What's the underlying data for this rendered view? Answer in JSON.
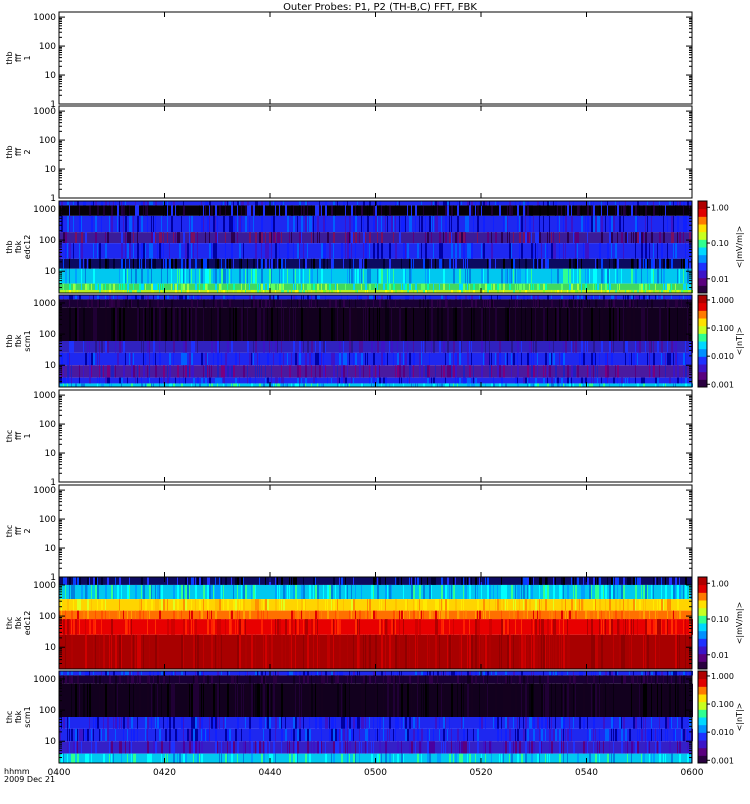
{
  "title": "Outer Probes: P1, P2 (TH-B,C) FFT, FBK",
  "colors": {
    "frame": "#000000",
    "background": "#ffffff",
    "colormap": [
      "#2a0040",
      "#5a007f",
      "#3c14c8",
      "#1e32ff",
      "#0090ff",
      "#00d8ff",
      "#30ff90",
      "#c8ff20",
      "#ffe000",
      "#ff7a00",
      "#e00000",
      "#b00000"
    ]
  },
  "chart_data": [
    {
      "type": "heatmap",
      "panel_id": "thb-fff-1",
      "ylabel_lines": [
        "thb",
        "fff",
        "1"
      ],
      "yscale": "log",
      "ylim": [
        1,
        1500
      ],
      "yticks": [
        1,
        10,
        100,
        1000
      ],
      "ytick_labels": [
        "1",
        "10",
        "100",
        "1000"
      ],
      "has_data": false
    },
    {
      "type": "heatmap",
      "panel_id": "thb-fff-2",
      "ylabel_lines": [
        "thb",
        "fff",
        "2"
      ],
      "yscale": "log",
      "ylim": [
        1,
        1500
      ],
      "yticks": [
        1,
        10,
        100,
        1000
      ],
      "ytick_labels": [
        "1",
        "10",
        "100",
        "1000"
      ],
      "has_data": false
    },
    {
      "type": "heatmap",
      "panel_id": "thb-fbk-edc12",
      "ylabel_lines": [
        "thb",
        "fbk",
        "edc12"
      ],
      "yscale": "log",
      "ylim": [
        2,
        1800
      ],
      "yticks": [
        10,
        100,
        1000
      ],
      "ytick_labels": [
        "10",
        "100",
        "1000"
      ],
      "has_data": true,
      "colorbar": {
        "label": "<|mV/m|>",
        "scale": "log",
        "range": [
          0.004,
          1.5
        ],
        "ticks": [
          0.01,
          0.1,
          1.0
        ],
        "tick_labels": [
          "0.01",
          "0.10",
          "1.00"
        ]
      },
      "bands": [
        {
          "freq_range": [
            1300,
            1800
          ],
          "dominant_level": "blue"
        },
        {
          "freq_range": [
            600,
            1300
          ],
          "dominant_level": "black"
        },
        {
          "freq_range": [
            180,
            600
          ],
          "dominant_level": "blue"
        },
        {
          "freq_range": [
            80,
            180
          ],
          "dominant_level": "indigo-purple"
        },
        {
          "freq_range": [
            25,
            80
          ],
          "dominant_level": "blue"
        },
        {
          "freq_range": [
            12,
            25
          ],
          "dominant_level": "blue-black"
        },
        {
          "freq_range": [
            4,
            12
          ],
          "dominant_level": "cyan"
        },
        {
          "freq_range": [
            2.5,
            4
          ],
          "dominant_level": "green"
        },
        {
          "freq_range": [
            2,
            2.5
          ],
          "dominant_level": "yellow-green"
        }
      ]
    },
    {
      "type": "heatmap",
      "panel_id": "thb-fbk-scm1",
      "ylabel_lines": [
        "thb",
        "fbk",
        "scm1"
      ],
      "yscale": "log",
      "ylim": [
        2,
        1800
      ],
      "yticks": [
        10,
        100,
        1000
      ],
      "ytick_labels": [
        "10",
        "100",
        "1000"
      ],
      "has_data": true,
      "colorbar": {
        "label": "<|nT|>",
        "scale": "log",
        "range": [
          0.0008,
          1.5
        ],
        "ticks": [
          0.001,
          0.01,
          0.1,
          1.0
        ],
        "tick_labels": [
          "0.001",
          "0.010",
          "0.100",
          "1.000"
        ]
      },
      "bands": [
        {
          "freq_range": [
            1300,
            1800
          ],
          "dominant_level": "blue"
        },
        {
          "freq_range": [
            700,
            1300
          ],
          "dominant_level": "dark-purple"
        },
        {
          "freq_range": [
            60,
            700
          ],
          "dominant_level": "black-purple"
        },
        {
          "freq_range": [
            25,
            60
          ],
          "dominant_level": "blue-purple"
        },
        {
          "freq_range": [
            10,
            25
          ],
          "dominant_level": "blue"
        },
        {
          "freq_range": [
            4,
            10
          ],
          "dominant_level": "purple"
        },
        {
          "freq_range": [
            2.6,
            4
          ],
          "dominant_level": "blue"
        },
        {
          "freq_range": [
            2,
            2.6
          ],
          "dominant_level": "cyan"
        }
      ]
    },
    {
      "type": "heatmap",
      "panel_id": "thc-fff-1",
      "ylabel_lines": [
        "thc",
        "fff",
        "1"
      ],
      "yscale": "log",
      "ylim": [
        1,
        1500
      ],
      "yticks": [
        1,
        10,
        100,
        1000
      ],
      "ytick_labels": [
        "1",
        "10",
        "100",
        "1000"
      ],
      "has_data": false
    },
    {
      "type": "heatmap",
      "panel_id": "thc-fff-2",
      "ylabel_lines": [
        "thc",
        "fff",
        "2"
      ],
      "yscale": "log",
      "ylim": [
        1,
        1500
      ],
      "yticks": [
        1,
        10,
        100,
        1000
      ],
      "ytick_labels": [
        "1",
        "10",
        "100",
        "1000"
      ],
      "has_data": false
    },
    {
      "type": "heatmap",
      "panel_id": "thc-fbk-edc12",
      "ylabel_lines": [
        "thc",
        "fbk",
        "edc12"
      ],
      "yscale": "log",
      "ylim": [
        2,
        1800
      ],
      "yticks": [
        10,
        100,
        1000
      ],
      "ytick_labels": [
        "10",
        "100",
        "1000"
      ],
      "has_data": true,
      "colorbar": {
        "label": "<|mV/m|>",
        "scale": "log",
        "range": [
          0.004,
          1.5
        ],
        "ticks": [
          0.01,
          0.1,
          1.0
        ],
        "tick_labels": [
          "0.01",
          "0.10",
          "1.00"
        ]
      },
      "bands": [
        {
          "freq_range": [
            1000,
            1800
          ],
          "dominant_level": "blue-black"
        },
        {
          "freq_range": [
            350,
            1000
          ],
          "dominant_level": "cyan"
        },
        {
          "freq_range": [
            150,
            350
          ],
          "dominant_level": "yellow"
        },
        {
          "freq_range": [
            80,
            150
          ],
          "dominant_level": "orange"
        },
        {
          "freq_range": [
            25,
            80
          ],
          "dominant_level": "red"
        },
        {
          "freq_range": [
            2,
            25
          ],
          "dominant_level": "dark-red"
        }
      ]
    },
    {
      "type": "heatmap",
      "panel_id": "thc-fbk-scm1",
      "ylabel_lines": [
        "thc",
        "fbk",
        "scm1"
      ],
      "yscale": "log",
      "ylim": [
        2,
        1800
      ],
      "yticks": [
        10,
        100,
        1000
      ],
      "ytick_labels": [
        "10",
        "100",
        "1000"
      ],
      "has_data": true,
      "colorbar": {
        "label": "<|nT|>",
        "scale": "log",
        "range": [
          0.0008,
          1.5
        ],
        "ticks": [
          0.001,
          0.01,
          0.1,
          1.0
        ],
        "tick_labels": [
          "0.001",
          "0.010",
          "0.100",
          "1.000"
        ]
      },
      "bands": [
        {
          "freq_range": [
            1300,
            1800
          ],
          "dominant_level": "blue"
        },
        {
          "freq_range": [
            700,
            1300
          ],
          "dominant_level": "dark-purple"
        },
        {
          "freq_range": [
            60,
            700
          ],
          "dominant_level": "black-purple"
        },
        {
          "freq_range": [
            25,
            60
          ],
          "dominant_level": "blue"
        },
        {
          "freq_range": [
            10,
            25
          ],
          "dominant_level": "blue"
        },
        {
          "freq_range": [
            4,
            10
          ],
          "dominant_level": "purple-blue"
        },
        {
          "freq_range": [
            2,
            4
          ],
          "dominant_level": "cyan"
        }
      ]
    }
  ],
  "x_axis": {
    "label_lines": [
      "hhmm",
      "2009 Dec 21"
    ],
    "range": [
      "04:00",
      "06:00"
    ],
    "ticks": [
      "0400",
      "0420",
      "0440",
      "0500",
      "0520",
      "0540",
      "0600"
    ]
  }
}
